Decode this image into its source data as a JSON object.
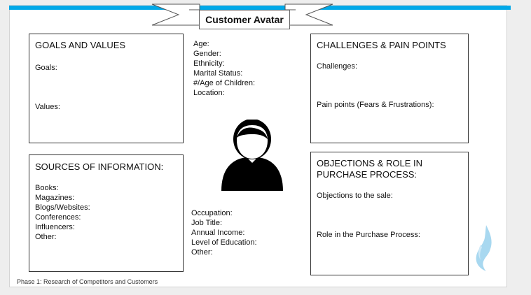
{
  "title": "Customer Avatar",
  "demographics_top": [
    "Age:",
    "Gender:",
    "Ethnicity:",
    "Marital Status:",
    "#/Age of Children:",
    "Location:"
  ],
  "demographics_bottom": [
    "Occupation:",
    "Job Title:",
    "Annual Income:",
    "Level of Education:",
    "Other:"
  ],
  "goals": {
    "title": "GOALS AND VALUES",
    "goals_label": "Goals:",
    "values_label": "Values:"
  },
  "challenges": {
    "title": "CHALLENGES & PAIN POINTS",
    "challenges_label": "Challenges:",
    "pain_label": "Pain points (Fears & Frustrations):"
  },
  "sources": {
    "title": "SOURCES OF INFORMATION:",
    "items": [
      "Books:",
      "Magazines:",
      "Blogs/Websites:",
      "Conferences:",
      "Influencers:",
      "Other:"
    ]
  },
  "objections": {
    "title_line1": "OBJECTIONS & ROLE IN",
    "title_line2": "PURCHASE PROCESS:",
    "objections_label": "Objections to the sale:",
    "role_label": "Role in the Purchase Process:"
  },
  "footer": "Phase 1: Research of Competitors and Customers",
  "icons": {
    "avatar": "person-silhouette-icon",
    "logo": "flame-logo-icon"
  },
  "colors": {
    "accent": "#00a8e8",
    "logo": "#a8d8f0"
  }
}
